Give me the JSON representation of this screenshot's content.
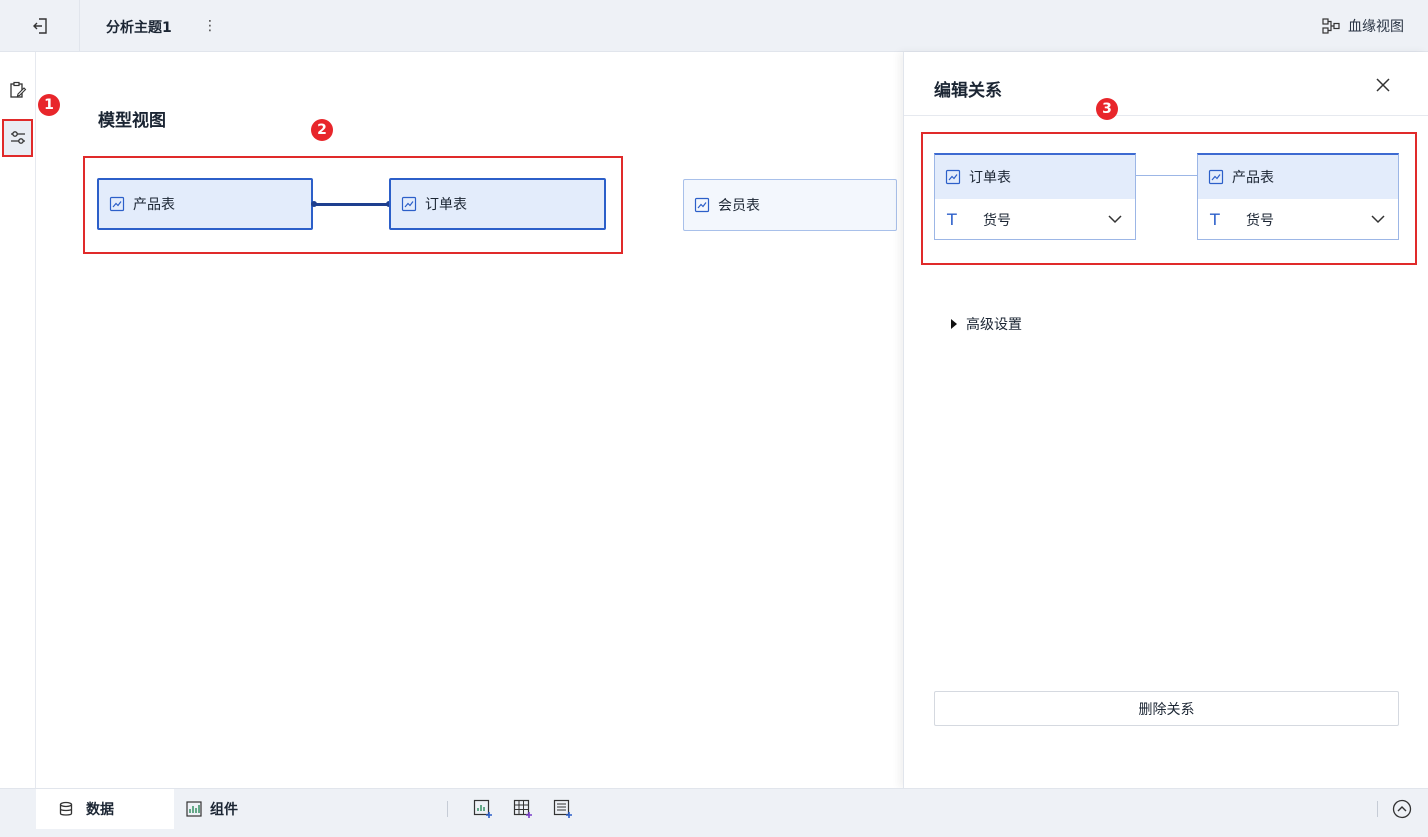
{
  "header": {
    "title": "分析主题1",
    "more": "⋮",
    "lineage_label": "血缘视图"
  },
  "badges": {
    "b1": "1",
    "b2": "2",
    "b3": "3"
  },
  "canvas": {
    "title": "模型视图",
    "tables": [
      "产品表",
      "订单表",
      "会员表"
    ]
  },
  "panel": {
    "title": "编辑关系",
    "left_table": "订单表",
    "left_field": "货号",
    "right_table": "产品表",
    "right_field": "货号",
    "field_type_glyph": "T",
    "advanced_label": "高级设置",
    "delete_label": "删除关系"
  },
  "bottom": {
    "tab_data": "数据",
    "tab_components": "组件"
  },
  "colors": {
    "accent": "#2c5fc9",
    "highlight": "#e02a2a",
    "node_fill": "#e3ecfb"
  }
}
